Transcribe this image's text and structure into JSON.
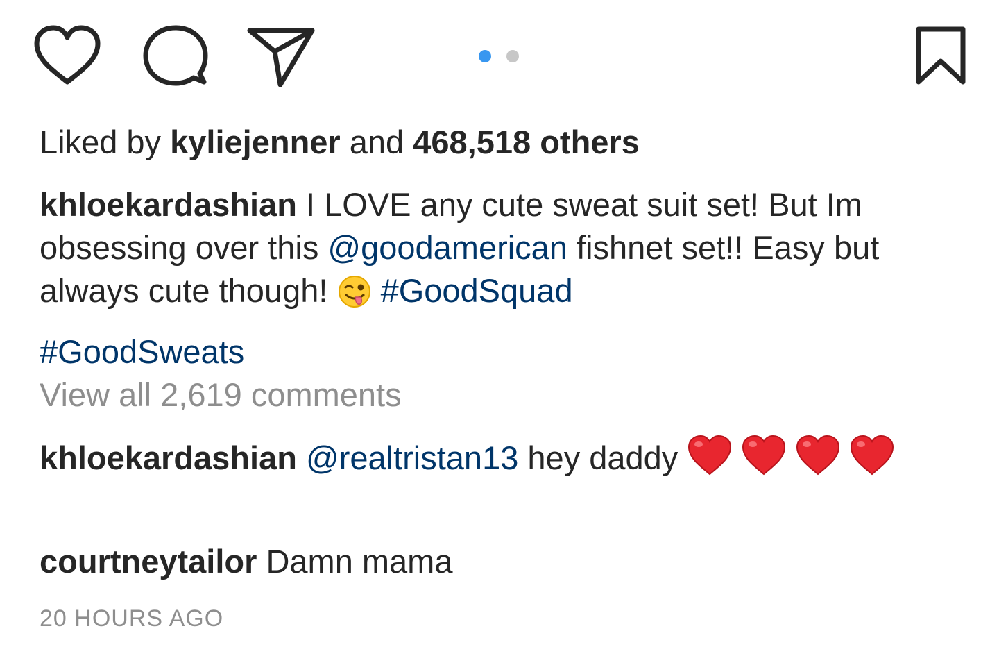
{
  "actions": {
    "like_icon": "heart-outline",
    "comment_icon": "speech-bubble",
    "share_icon": "paper-plane",
    "save_icon": "bookmark"
  },
  "carousel": {
    "total": 2,
    "active_index": 0,
    "active_color": "#3897f0",
    "inactive_color": "#c7c7c7"
  },
  "likes": {
    "prefix": "Liked by ",
    "user": "kyliejenner",
    "middle": " and ",
    "count": "468,518 others"
  },
  "caption": {
    "username": "khloekardashian",
    "text_1": " I LOVE any cute sweat suit set! But Im obsessing over this ",
    "mention": "@goodamerican",
    "text_2": " fishnet set!! Easy but always cute though! ",
    "emoji": "winking-face-with-tongue",
    "hashtag_1": "#GoodSquad",
    "hashtag_2": "#GoodSweats"
  },
  "view_all_comments": "View all 2,619 comments",
  "comments": [
    {
      "username": "khloekardashian",
      "mention": "@realtristan13",
      "text": " hey daddy ",
      "emoji": "red-heart",
      "emoji_count": 4
    },
    {
      "username": "courtneytailor",
      "text": " Damn mama"
    }
  ],
  "timestamp": "20 HOURS AGO",
  "colors": {
    "text": "#262626",
    "link": "#003569",
    "muted": "#8e8e8e",
    "heart_red": "#e8262f"
  }
}
